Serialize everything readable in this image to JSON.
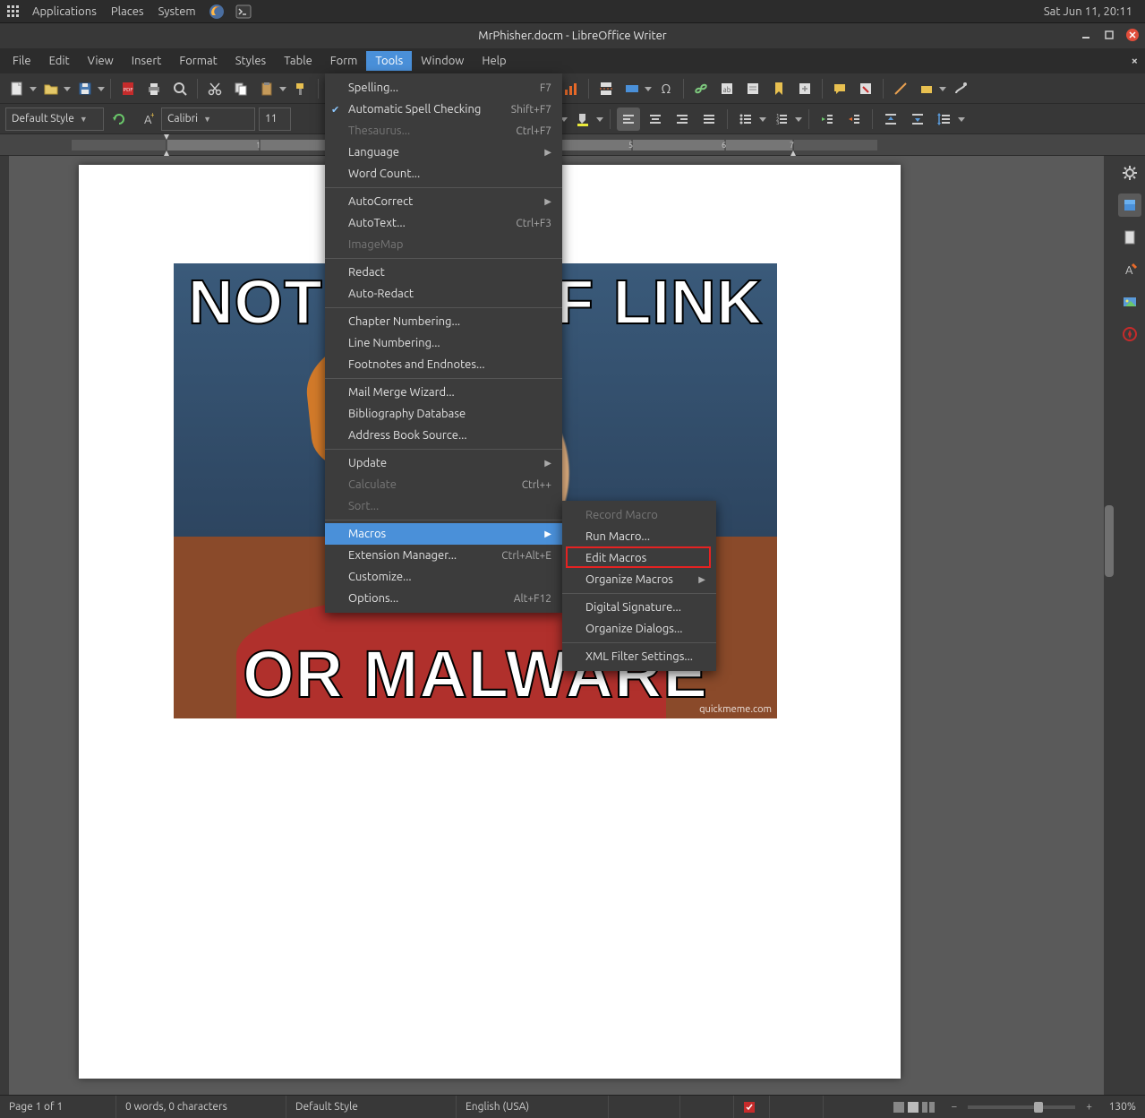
{
  "os_panel": {
    "applications": "Applications",
    "places": "Places",
    "system": "System",
    "clock": "Sat Jun 11, 20:11"
  },
  "titlebar": {
    "title": "MrPhisher.docm - LibreOffice Writer"
  },
  "menubar": {
    "file": "File",
    "edit": "Edit",
    "view": "View",
    "insert": "Insert",
    "format": "Format",
    "styles": "Styles",
    "table": "Table",
    "form": "Form",
    "tools": "Tools",
    "window": "Window",
    "help": "Help"
  },
  "tools_menu": {
    "spelling": "Spelling...",
    "spelling_shortcut": "F7",
    "auto_spellcheck": "Automatic Spell Checking",
    "auto_spellcheck_shortcut": "Shift+F7",
    "thesaurus": "Thesaurus...",
    "thesaurus_shortcut": "Ctrl+F7",
    "language": "Language",
    "word_count": "Word Count...",
    "autocorrect": "AutoCorrect",
    "autotext": "AutoText...",
    "autotext_shortcut": "Ctrl+F3",
    "imagemap": "ImageMap",
    "redact": "Redact",
    "auto_redact": "Auto-Redact",
    "chapter_numbering": "Chapter Numbering...",
    "line_numbering": "Line Numbering...",
    "footnotes": "Footnotes and Endnotes...",
    "mail_merge": "Mail Merge Wizard...",
    "bibliography": "Bibliography Database",
    "address_book": "Address Book Source...",
    "update": "Update",
    "calculate": "Calculate",
    "calculate_shortcut": "Ctrl++",
    "sort": "Sort...",
    "macros": "Macros",
    "extension_mgr": "Extension Manager...",
    "extension_mgr_shortcut": "Ctrl+Alt+E",
    "customize": "Customize...",
    "options": "Options...",
    "options_shortcut": "Alt+F12"
  },
  "macros_menu": {
    "record": "Record Macro",
    "run": "Run Macro...",
    "edit": "Edit Macros",
    "organize": "Organize Macros",
    "digital_sig": "Digital Signature...",
    "organize_dialogs": "Organize Dialogs...",
    "xml_filter": "XML Filter Settings..."
  },
  "format_bar": {
    "paragraph_style": "Default Style",
    "font_name": "Calibri",
    "font_size": "11"
  },
  "document": {
    "meme_top": "NOT SURE IF LINK",
    "meme_bottom": "OR MALWARE",
    "watermark": "quickmeme.com"
  },
  "statusbar": {
    "page_info": "Page 1 of 1",
    "word_count": "0 words, 0 characters",
    "style": "Default Style",
    "language": "English (USA)",
    "zoom": "130%"
  }
}
